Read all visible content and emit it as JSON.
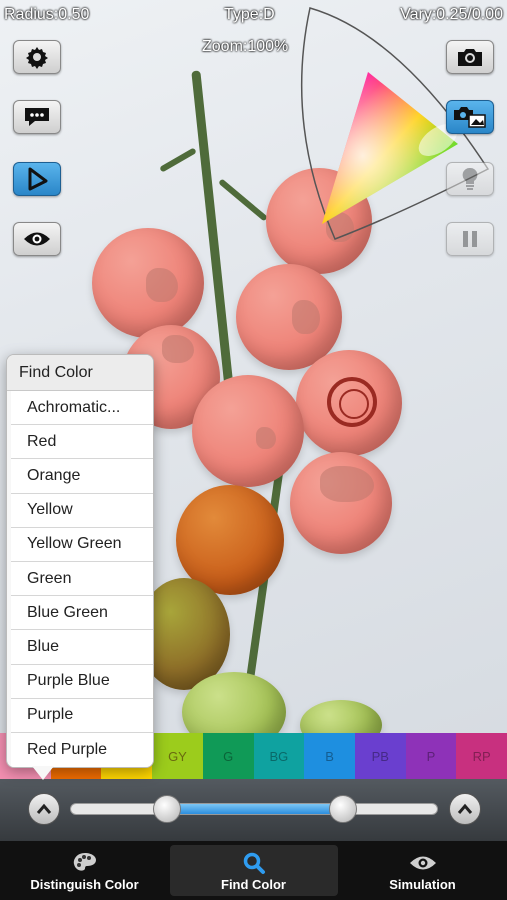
{
  "hud": {
    "radius": "Radius:0.50",
    "type": "Type:D",
    "vary": "Vary:0.25/0.00",
    "zoom": "Zoom:100%"
  },
  "toolbar_left": [
    {
      "name": "settings-button",
      "icon": "gear-icon",
      "active": false
    },
    {
      "name": "message-button",
      "icon": "speech-bubble-icon",
      "active": false
    },
    {
      "name": "triangle-mode-button",
      "icon": "triangle-cursor-icon",
      "active": true
    },
    {
      "name": "view-button",
      "icon": "eye-icon",
      "active": false
    }
  ],
  "toolbar_right": [
    {
      "name": "camera-button",
      "icon": "camera-icon",
      "active": false
    },
    {
      "name": "photo-library-button",
      "icon": "camera-photo-icon",
      "active": true
    },
    {
      "name": "light-button",
      "icon": "lightbulb-icon",
      "active": false
    },
    {
      "name": "pause-button",
      "icon": "pause-icon",
      "active": false
    }
  ],
  "color_band": [
    {
      "label": "",
      "color": "#f48fb1"
    },
    {
      "label": "",
      "color": "#ef6c00"
    },
    {
      "label": "Y",
      "color": "#ffd600"
    },
    {
      "label": "GY",
      "color": "#9ccc1c"
    },
    {
      "label": "G",
      "color": "#109a57"
    },
    {
      "label": "BG",
      "color": "#0fa2a0"
    },
    {
      "label": "B",
      "color": "#1e8fe0"
    },
    {
      "label": "PB",
      "color": "#6a3fcf"
    },
    {
      "label": "P",
      "color": "#8e32b8"
    },
    {
      "label": "RP",
      "color": "#c8307f"
    }
  ],
  "slider": {
    "low_value": 0.26,
    "high_value": 0.74
  },
  "tabs": [
    {
      "label": "Distinguish Color",
      "icon": "palette-icon",
      "selected": false
    },
    {
      "label": "Find Color",
      "icon": "search-icon",
      "selected": true
    },
    {
      "label": "Simulation",
      "icon": "eye-icon",
      "selected": false
    }
  ],
  "find_color_menu": {
    "title": "Find Color",
    "items": [
      "Achromatic...",
      "Red",
      "Orange",
      "Yellow",
      "Yellow Green",
      "Green",
      "Blue Green",
      "Blue",
      "Purple Blue",
      "Purple",
      "Red Purple"
    ]
  },
  "colors": {
    "accent": "#2a86c8",
    "highlight_red": "#ee8378"
  }
}
